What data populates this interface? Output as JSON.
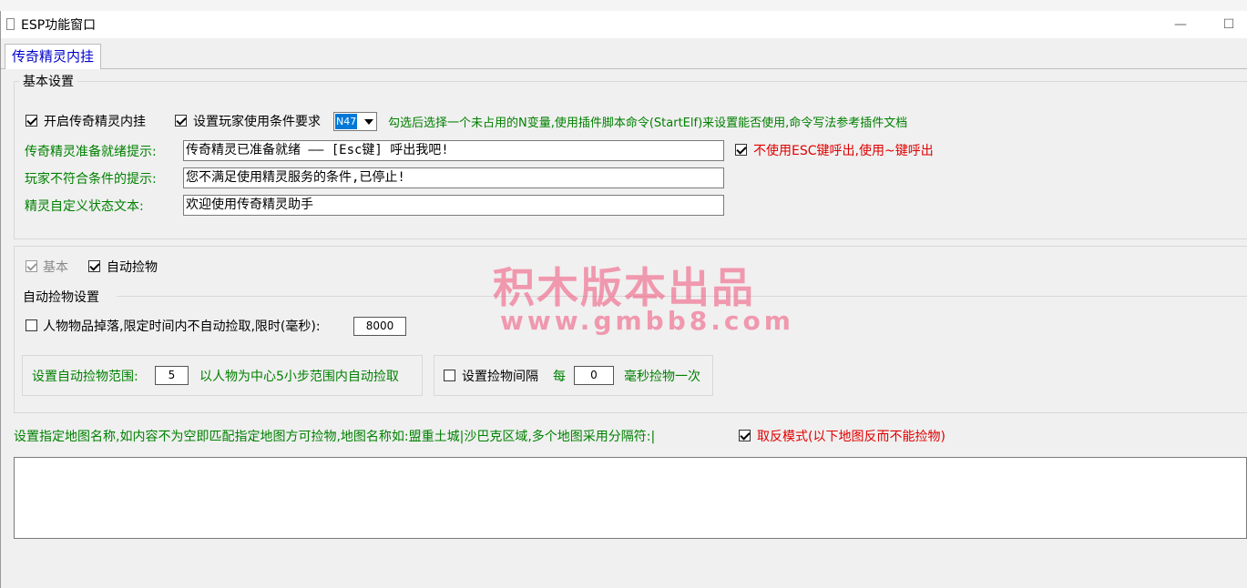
{
  "window": {
    "title": "ESP功能窗口",
    "minimize": "—",
    "maximize": "☐"
  },
  "tab": {
    "label": "传奇精灵内挂"
  },
  "basic_settings": {
    "legend": "基本设置",
    "enable_label": "开启传奇精灵内挂",
    "enable_checked": true,
    "condition_label": "设置玩家使用条件要求",
    "condition_checked": true,
    "variable_value": "N47",
    "condition_hint": "勾选后选择一个未占用的N变量,使用插件脚本命令(StartElf)来设置能否使用,命令写法参考插件文档",
    "ready_prompt_label": "传奇精灵准备就绪提示:",
    "ready_prompt_value": "传奇精灵已准备就绪 —— [Esc键] 呼出我吧!",
    "no_esc_label": "不使用ESC键呼出,使用~键呼出",
    "no_esc_checked": true,
    "unqualified_label": "玩家不符合条件的提示:",
    "unqualified_value": "您不满足使用精灵服务的条件,已停止!",
    "status_text_label": "精灵自定义状态文本:",
    "status_text_value": "欢迎使用传奇精灵助手"
  },
  "features": {
    "basic_label": "基本",
    "basic_checked": true,
    "auto_pickup_label": "自动捡物",
    "auto_pickup_checked": true
  },
  "auto_pickup_settings": {
    "legend": "自动捡物设置",
    "drop_delay_label": "人物物品掉落,限定时间内不自动捡取,限时(毫秒):",
    "drop_delay_checked": false,
    "drop_delay_value": "8000",
    "range_label": "设置自动捡物范围:",
    "range_value": "5",
    "range_hint": "以人物为中心5小步范围内自动捡取",
    "interval_label": "设置捡物间隔",
    "interval_checked": false,
    "interval_prefix": "每",
    "interval_value": "0",
    "interval_suffix": "毫秒捡物一次"
  },
  "map_settings": {
    "description": "设置指定地图名称,如内容不为空即匹配指定地图方可捡物,地图名称如:盟重土城|沙巴克区域,多个地图采用分隔符:|",
    "invert_label": "取反模式(以下地图反而不能捡物)",
    "invert_checked": true,
    "map_list_value": ""
  },
  "watermark": {
    "line1": "积木版本出品",
    "line2": "www.gmbb8.com"
  }
}
